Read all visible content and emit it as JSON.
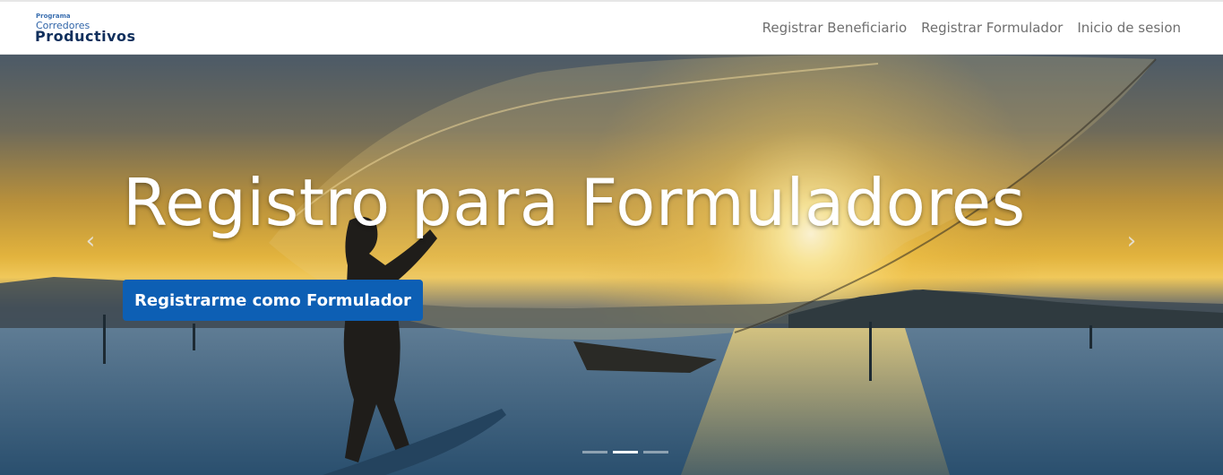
{
  "logo": {
    "line1": "Programa",
    "line2": "Corredores",
    "line3": "Productivos"
  },
  "nav": {
    "items": [
      {
        "label": "Registrar Beneficiario"
      },
      {
        "label": "Registrar Formulador"
      },
      {
        "label": "Inicio de sesion"
      }
    ]
  },
  "hero": {
    "title": "Registro para Formuladores",
    "cta_label": "Registrarme como Formulador",
    "prev_icon": "chevron-left-icon",
    "next_icon": "chevron-right-icon"
  },
  "colors": {
    "cta_background": "#0d5fb4",
    "nav_text": "#6f6f6f",
    "logo_dark": "#0f2f5c",
    "logo_blue": "#2f64a8"
  }
}
